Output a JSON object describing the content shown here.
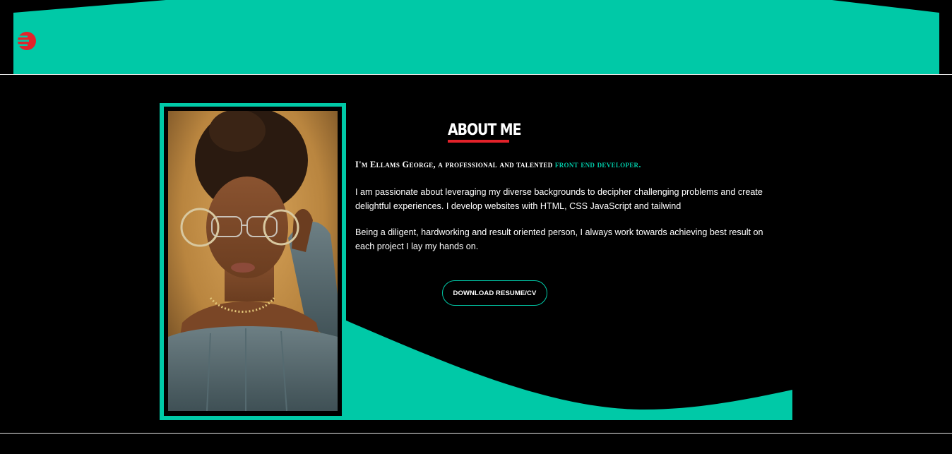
{
  "header": {
    "logo_icon": "brand-logo-icon"
  },
  "about": {
    "title": "ABOUT ME",
    "intro_prefix": "I'm Ellams George, a professional and talented ",
    "intro_role": "front end developer.",
    "paragraph_1": "I am passionate about leveraging my diverse backgrounds to decipher challenging problems and create delightful experiences. I develop websites with HTML, CSS JavaScript and tailwind",
    "paragraph_2": "Being a diligent, hardworking and result oriented person, I always work towards achieving best result on each project I lay my hands on.",
    "download_label": "DOWNLOAD RESUME/CV",
    "photo_icon": "profile-photo"
  },
  "colors": {
    "accent": "#00c9a7",
    "brand_red": "#e3222a",
    "background": "#000000",
    "text": "#ffffff"
  }
}
